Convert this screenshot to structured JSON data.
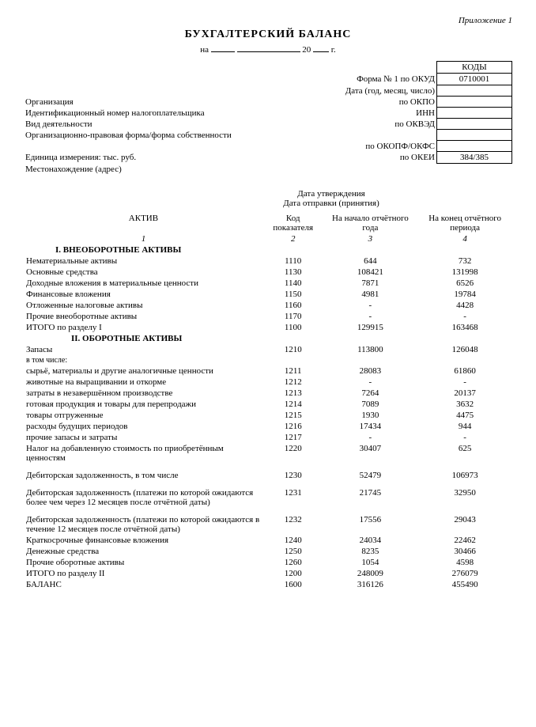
{
  "annex": "Приложение 1",
  "title": "БУХГАЛТЕРСКИЙ БАЛАНС",
  "date_prefix": "на",
  "date_year_suffix": "20",
  "date_year_suffix2": "г.",
  "codes_header": "КОДЫ",
  "header_rows": [
    {
      "label_left": "",
      "label_right": "Форма № 1 по ОКУД",
      "code": "0710001"
    },
    {
      "label_left": "",
      "label_right": "Дата (год, месяц, число)",
      "code": ""
    },
    {
      "label_left": "Организация",
      "label_right": "по ОКПО",
      "code": ""
    },
    {
      "label_left": "Идентификационный номер налогоплательщика",
      "label_right": "ИНН",
      "code": ""
    },
    {
      "label_left": "Вид деятельности",
      "label_right": "по ОКВЭД",
      "code": ""
    },
    {
      "label_left": "Организационно-правовая форма/форма собственности",
      "label_right": "",
      "code": ""
    },
    {
      "label_left": "",
      "label_right": "по ОКОПФ/ОКФС",
      "code": ""
    },
    {
      "label_left": "Единица измерения: тыс. руб.",
      "label_right": "по ОКЕИ",
      "code": "384/385"
    },
    {
      "label_left": "Местонахождение (адрес)",
      "label_right": "",
      "code": ""
    }
  ],
  "approval": {
    "line1": "Дата утверждения",
    "line2": "Дата отправки (принятия)"
  },
  "columns": {
    "c1": "АКТИВ",
    "c2": "Код показателя",
    "c3": "На начало отчётного года",
    "c4": "На конец отчётного периода",
    "n1": "1",
    "n2": "2",
    "n3": "3",
    "n4": "4"
  },
  "section1_title": "I. ВНЕОБОРОТНЫЕ АКТИВЫ",
  "rows1": [
    {
      "name": "Нематериальные активы",
      "code": "1110",
      "v1": "644",
      "v2": "732"
    },
    {
      "name": "Основные средства",
      "code": "1130",
      "v1": "108421",
      "v2": "131998"
    },
    {
      "name": "Доходные вложения в материальные ценности",
      "code": "1140",
      "v1": "7871",
      "v2": "6526"
    },
    {
      "name": "Финансовые вложения",
      "code": "1150",
      "v1": "4981",
      "v2": "19784"
    },
    {
      "name": "Отложенные налоговые активы",
      "code": "1160",
      "v1": "-",
      "v2": "4428"
    },
    {
      "name": "Прочие внеоборотные активы",
      "code": "1170",
      "v1": "-",
      "v2": "-"
    }
  ],
  "section1_total": {
    "name": "ИТОГО по разделу I",
    "code": "1100",
    "v1": "129915",
    "v2": "163468"
  },
  "section2_title": "II. ОБОРОТНЫЕ АКТИВЫ",
  "rows2a": {
    "name": "Запасы",
    "code": "1210",
    "v1": "113800",
    "v2": "126048"
  },
  "rows2a_sub_label": "в том числе:",
  "rows2a_sub": [
    {
      "name": "сырьё, материалы и другие аналогичные ценности",
      "code": "1211",
      "v1": "28083",
      "v2": "61860"
    },
    {
      "name": "животные на выращивании и откорме",
      "code": "1212",
      "v1": "-",
      "v2": "-"
    },
    {
      "name": "затраты в незавершённом производстве",
      "code": "1213",
      "v1": "7264",
      "v2": "20137"
    },
    {
      "name": "готовая продукция и товары для перепродажи",
      "code": "1214",
      "v1": "7089",
      "v2": "3632"
    },
    {
      "name": "товары отгруженные",
      "code": "1215",
      "v1": "1930",
      "v2": "4475"
    },
    {
      "name": "расходы будущих периодов",
      "code": "1216",
      "v1": "17434",
      "v2": "944"
    },
    {
      "name": "прочие запасы и затраты",
      "code": "1217",
      "v1": "-",
      "v2": "-"
    }
  ],
  "rows2b": [
    {
      "name": "Налог на добавленную стоимость по приобретённым ценностям",
      "code": "1220",
      "v1": "30407",
      "v2": "625"
    },
    {
      "name": "Дебиторская задолженность, в том числе",
      "code": "1230",
      "v1": "52479",
      "v2": "106973"
    },
    {
      "name": "Дебиторская задолженность (платежи по которой ожидаются более чем через 12 месяцев после отчётной даты)",
      "code": "1231",
      "v1": "21745",
      "v2": "32950"
    },
    {
      "name": "Дебиторская задолженность (платежи по которой ожидаются в течение 12 месяцев после отчётной даты)",
      "code": "1232",
      "v1": "17556",
      "v2": "29043"
    },
    {
      "name": "Краткосрочные финансовые вложения",
      "code": "1240",
      "v1": "24034",
      "v2": "22462"
    },
    {
      "name": "Денежные средства",
      "code": "1250",
      "v1": "8235",
      "v2": "30466"
    },
    {
      "name": "Прочие оборотные активы",
      "code": "1260",
      "v1": "1054",
      "v2": "4598"
    }
  ],
  "section2_total": {
    "name": "ИТОГО по разделу II",
    "code": "1200",
    "v1": "248009",
    "v2": "276079"
  },
  "balance": {
    "name": "БАЛАНС",
    "code": "1600",
    "v1": "316126",
    "v2": "455490"
  }
}
